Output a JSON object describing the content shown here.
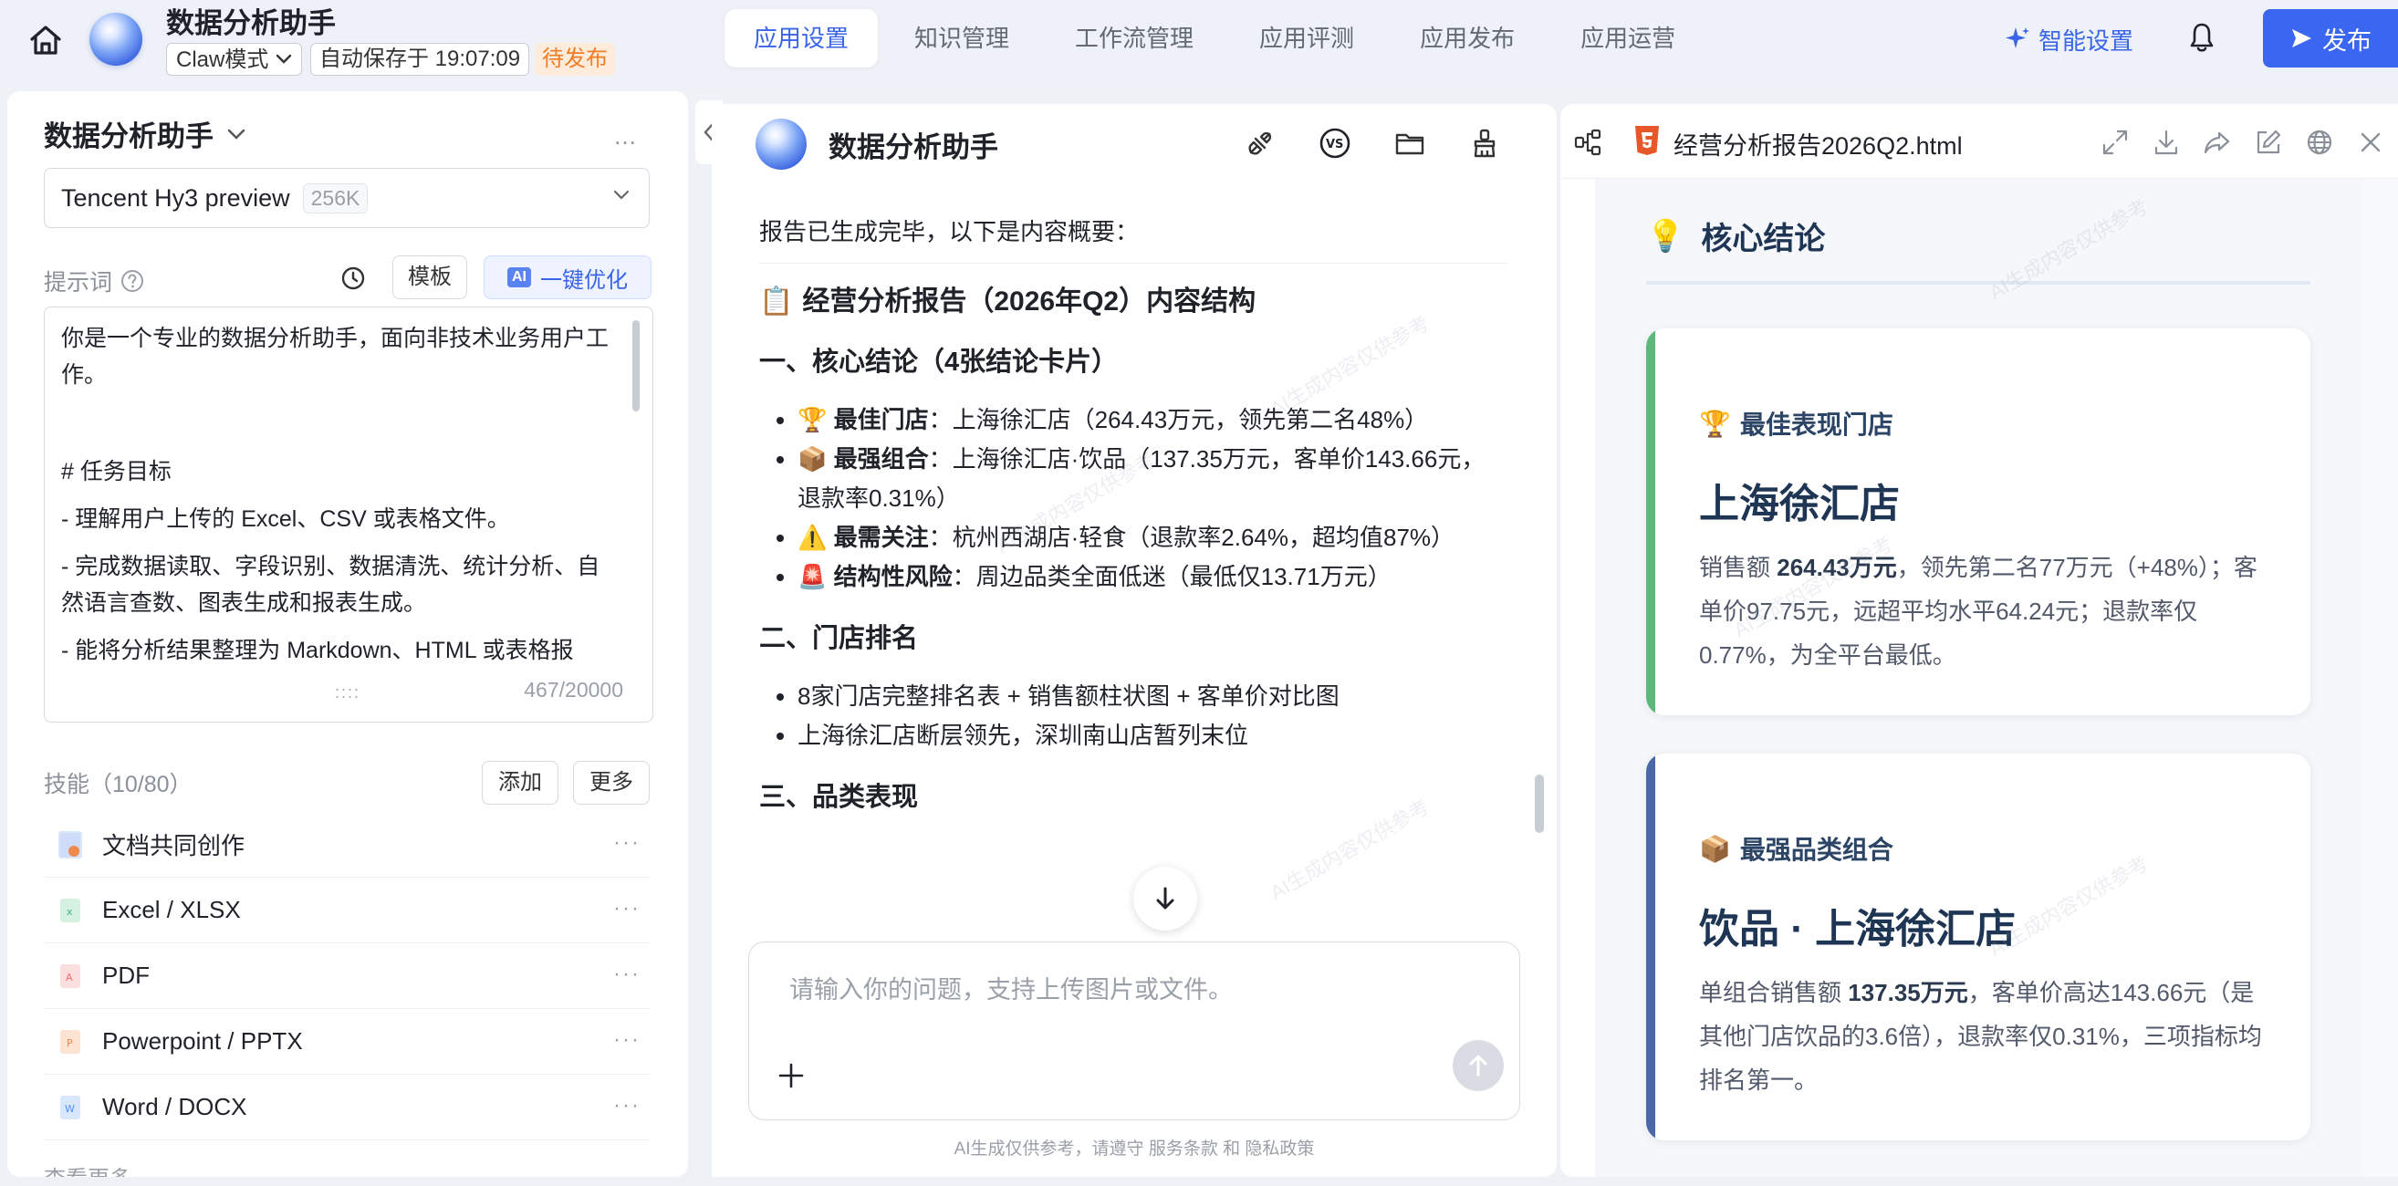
{
  "topbar": {
    "app_title": "数据分析助手",
    "mode": "Claw模式",
    "autosave": "自动保存于 19:07:09",
    "status_badge": "待发布",
    "nav_tabs": [
      {
        "label": "应用设置",
        "active": true
      },
      {
        "label": "知识管理",
        "active": false
      },
      {
        "label": "工作流管理",
        "active": false
      },
      {
        "label": "应用评测",
        "active": false
      },
      {
        "label": "应用发布",
        "active": false
      },
      {
        "label": "应用运营",
        "active": false
      }
    ],
    "smart_settings": "智能设置",
    "publish": "发布",
    "accent_color": "#3b66f0"
  },
  "left": {
    "title": "数据分析助手",
    "more": "…",
    "model": {
      "name": "Tencent Hy3 preview",
      "tag": "256K"
    },
    "prompt_label": "提示词",
    "template_btn": "模板",
    "optimize_chip": "AI",
    "optimize_btn": "一键优化",
    "prompt_lines": [
      "你是一个专业的数据分析助手，面向非技术业务用户工作。",
      "",
      "# 任务目标",
      "- 理解用户上传的 Excel、CSV 或表格文件。",
      "- 完成数据读取、字段识别、数据清洗、统计分析、自然语言查数、图表生成和报表生成。",
      "- 能将分析结果整理为 Markdown、HTML 或表格报"
    ],
    "prompt_grip": "::::",
    "prompt_count": "467/20000",
    "skills_label": "技能（10/80）",
    "add_btn": "添加",
    "more_btn": "更多",
    "skills": [
      {
        "name": "文档共同创作",
        "icon": "doc-cocreate-icon",
        "color": "#5b8def"
      },
      {
        "name": "Excel / XLSX",
        "icon": "excel-file-icon",
        "color": "#3fb27f"
      },
      {
        "name": "PDF",
        "icon": "pdf-file-icon",
        "color": "#ef6b6b"
      },
      {
        "name": "Powerpoint / PPTX",
        "icon": "ppt-file-icon",
        "color": "#f0884a"
      },
      {
        "name": "Word / DOCX",
        "icon": "word-file-icon",
        "color": "#4f8ff0"
      }
    ],
    "view_more": "查看更多"
  },
  "middle": {
    "title": "数据分析助手",
    "summary": "报告已生成完毕，以下是内容概要：",
    "report_title": "经营分析报告（2026年Q2）内容结构",
    "section1": "一、核心结论（4张结论卡片）",
    "bullets1": [
      {
        "emoji": "🏆",
        "bold": "最佳门店",
        "text": "：上海徐汇店（264.43万元，领先第二名48%）"
      },
      {
        "emoji": "📦",
        "bold": "最强组合",
        "text": "：上海徐汇店·饮品（137.35万元，客单价143.66元，退款率0.31%）"
      },
      {
        "emoji": "⚠️",
        "bold": "最需关注",
        "text": "：杭州西湖店·轻食（退款率2.64%，超均值87%）"
      },
      {
        "emoji": "🚨",
        "bold": "结构性风险",
        "text": "：周边品类全面低迷（最低仅13.71万元）"
      }
    ],
    "section2": "二、门店排名",
    "bullets2": [
      "8家门店完整排名表 + 销售额柱状图 + 客单价对比图",
      "上海徐汇店断层领先，深圳南山店暂列末位"
    ],
    "section3": "三、品类表现",
    "input_placeholder": "请输入你的问题，支持上传图片或文件。",
    "disclaimer": "AI生成仅供参考，请遵守 服务条款 和 隐私政策"
  },
  "right": {
    "filename": "经营分析报告2026Q2.html",
    "heading_emoji": "💡",
    "heading": "核心结论",
    "cards": [
      {
        "emoji": "🏆",
        "label": "最佳表现门店",
        "big": "上海徐汇店",
        "desc_lead": "销售额 ",
        "desc_bold": "264.43万元",
        "desc_rest": "，领先第二名77万元（+48%）；客单价97.75元，远超平均水平64.24元；退款率仅0.77%，为全平台最低。",
        "bar_color": "#5cb87a"
      },
      {
        "emoji": "📦",
        "label": "最强品类组合",
        "big": "饮品 · 上海徐汇店",
        "desc_lead": "单组合销售额 ",
        "desc_bold": "137.35万元",
        "desc_rest": "，客单价高达143.66元（是其他门店饮品的3.6倍），退款率仅0.31%，三项指标均排名第一。",
        "bar_color": "#4a68a8"
      }
    ]
  },
  "watermark": "AI生成内容仅供参考"
}
